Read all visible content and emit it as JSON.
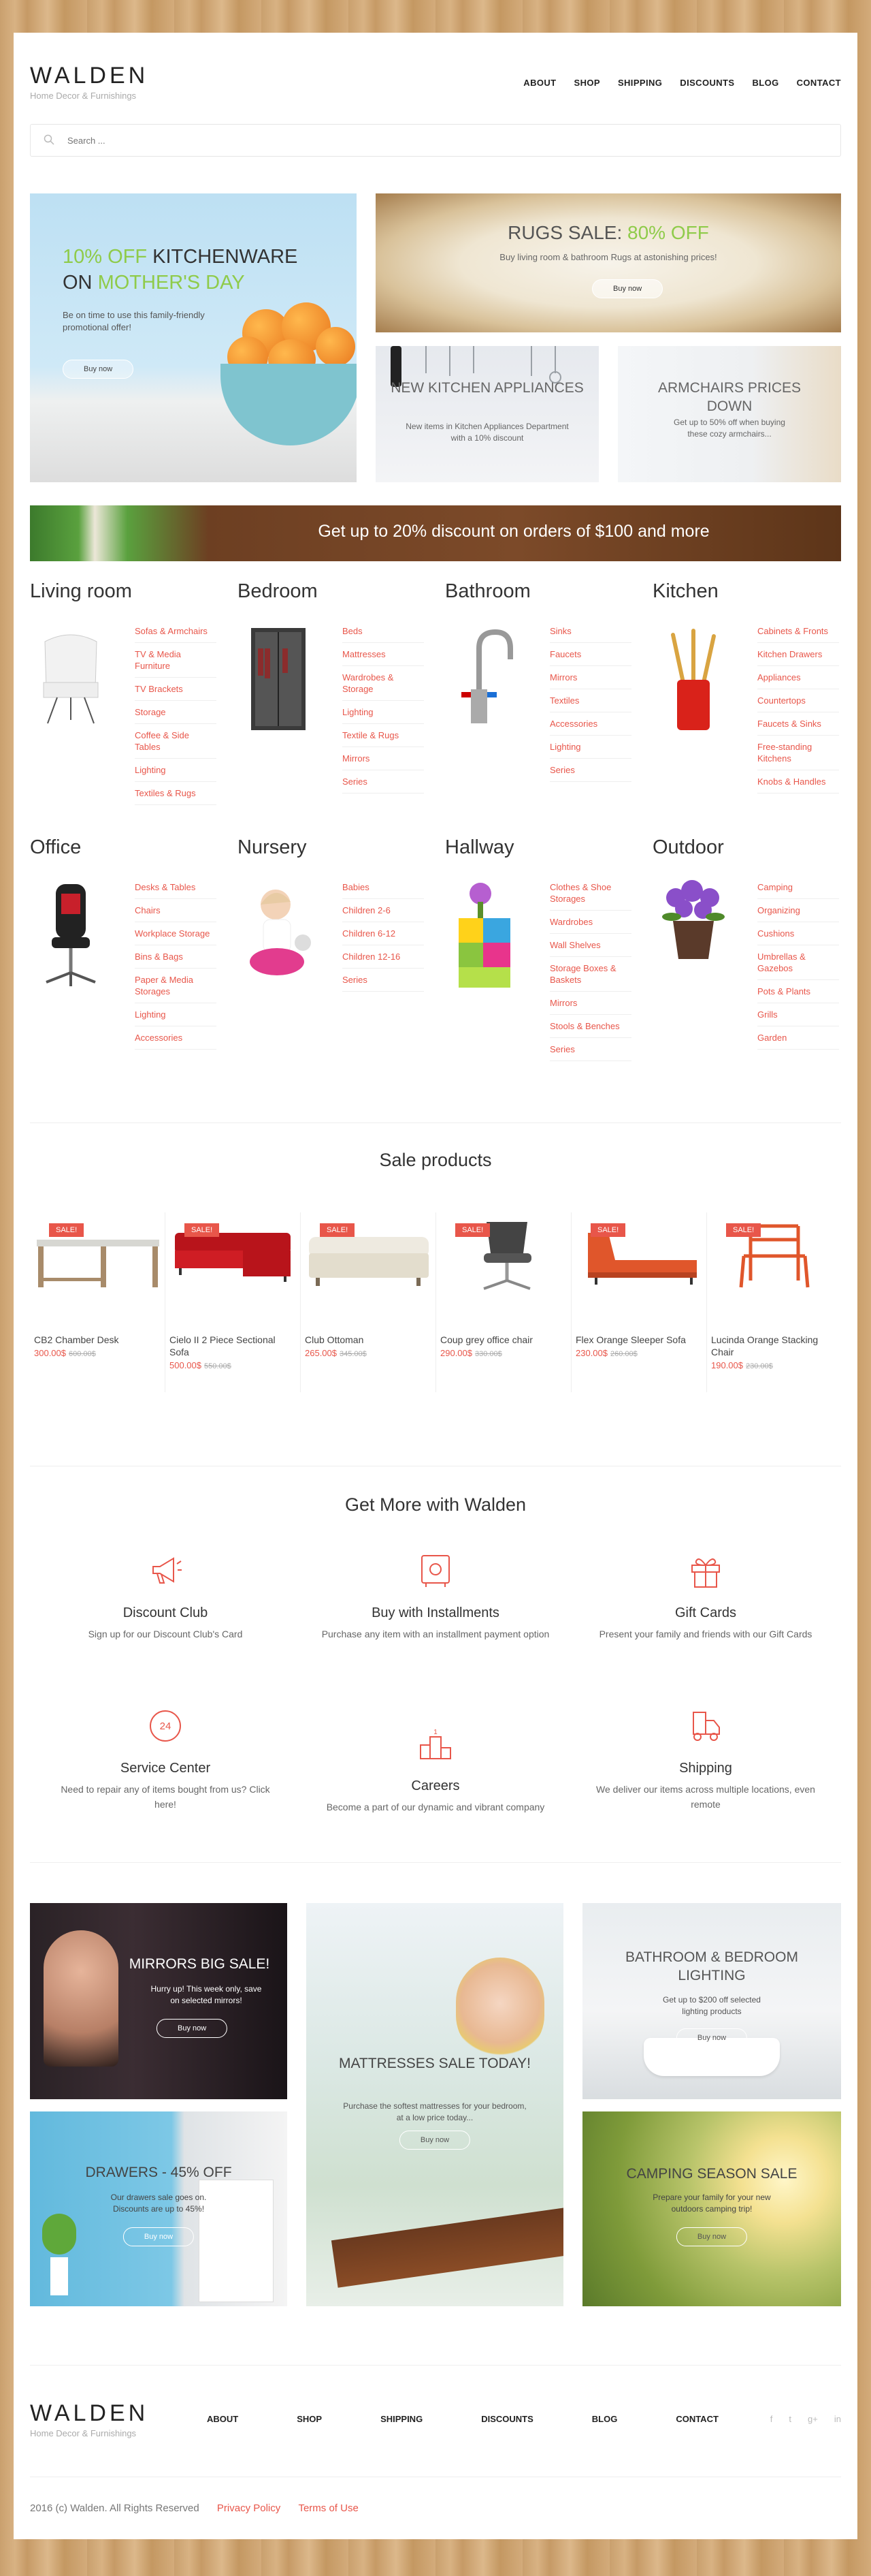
{
  "brand": {
    "name": "WALDEN",
    "tagline": "Home Decor & Furnishings"
  },
  "nav": [
    "ABOUT",
    "SHOP",
    "SHIPPING",
    "DISCOUNTS",
    "BLOG",
    "CONTACT"
  ],
  "search": {
    "placeholder": "Search ..."
  },
  "banners": {
    "kitchen": {
      "line1_accent": "10% OFF",
      "line1_rest": " KITCHENWARE",
      "line2_rest": "ON ",
      "line2_accent": "MOTHER'S DAY",
      "text": "Be on time to use this family-friendly promotional offer!",
      "button": "Buy now"
    },
    "rugs": {
      "title": "RUGS SALE: ",
      "title_accent": "80% OFF",
      "text": "Buy living room & bathroom Rugs at astonishing prices!",
      "button": "Buy now"
    },
    "appliances": {
      "title": "NEW KITCHEN APPLIANCES",
      "text": "New items in Kitchen Appliances Department with a 10% discount"
    },
    "armchairs": {
      "title": "ARMCHAIRS PRICES DOWN",
      "text": "Get up to 50% off when buying these cozy armchairs..."
    },
    "discount": {
      "text": "Get up to 20% discount on orders of $100 and more"
    }
  },
  "categories": [
    {
      "title": "Living room",
      "items": [
        "Sofas & Armchairs",
        "TV & Media Furniture",
        "TV Brackets",
        "Storage",
        "Coffee & Side Tables",
        "Lighting",
        "Textiles & Rugs"
      ]
    },
    {
      "title": "Bedroom",
      "items": [
        "Beds",
        "Mattresses",
        "Wardrobes & Storage",
        "Lighting",
        "Textile & Rugs",
        "Mirrors",
        "Series"
      ]
    },
    {
      "title": "Bathroom",
      "items": [
        "Sinks",
        "Faucets",
        "Mirrors",
        "Textiles",
        "Accessories",
        "Lighting",
        "Series"
      ]
    },
    {
      "title": "Kitchen",
      "items": [
        "Cabinets & Fronts",
        "Kitchen Drawers",
        "Appliances",
        "Countertops",
        "Faucets & Sinks",
        "Free-standing Kitchens",
        "Knobs & Handles"
      ]
    },
    {
      "title": "Office",
      "items": [
        "Desks & Tables",
        "Chairs",
        "Workplace Storage",
        "Bins & Bags",
        "Paper & Media Storages",
        "Lighting",
        "Accessories"
      ]
    },
    {
      "title": "Nursery",
      "items": [
        "Babies",
        "Children 2-6",
        "Children 6-12",
        "Children 12-16",
        "Series"
      ]
    },
    {
      "title": "Hallway",
      "items": [
        "Clothes & Shoe Storages",
        "Wardrobes",
        "Wall Shelves",
        "Storage Boxes & Baskets",
        "Mirrors",
        "Stools & Benches",
        "Series"
      ]
    },
    {
      "title": "Outdoor",
      "items": [
        "Camping",
        "Organizing",
        "Cushions",
        "Umbrellas & Gazebos",
        "Pots & Plants",
        "Grills",
        "Garden"
      ]
    }
  ],
  "sale": {
    "title": "Sale products",
    "badge": "SALE!",
    "products": [
      {
        "name": "CB2 Chamber Desk",
        "price": "300.00$",
        "old": "600.00$"
      },
      {
        "name": "Cielo II 2 Piece Sectional Sofa",
        "price": "500.00$",
        "old": "550.00$"
      },
      {
        "name": "Club Ottoman",
        "price": "265.00$",
        "old": "345.00$"
      },
      {
        "name": "Coup grey office chair",
        "price": "290.00$",
        "old": "330.00$"
      },
      {
        "name": "Flex Orange Sleeper Sofa",
        "price": "230.00$",
        "old": "260.00$"
      },
      {
        "name": "Lucinda Orange Stacking Chair",
        "price": "190.00$",
        "old": "230.00$"
      }
    ]
  },
  "services": {
    "title": "Get More with Walden",
    "items": [
      {
        "title": "Discount Club",
        "text": "Sign up for our Discount Club's Card"
      },
      {
        "title": "Buy with Installments",
        "text": "Purchase any item with an installment payment option"
      },
      {
        "title": "Gift Cards",
        "text": "Present your family and friends with our Gift Cards"
      },
      {
        "title": "Service Center",
        "text": "Need to repair any of items bought from us? Click here!"
      },
      {
        "title": "Careers",
        "text": "Become a part of our dynamic and vibrant company"
      },
      {
        "title": "Shipping",
        "text": "We deliver our items across multiple locations, even remote"
      }
    ]
  },
  "promos": {
    "mirrors": {
      "title": "MIRRORS BIG SALE!",
      "text": "Hurry up! This week only, save on selected mirrors!",
      "button": "Buy now"
    },
    "mattresses": {
      "title": "MATTRESSES SALE TODAY!",
      "text": "Purchase the softest mattresses for your bedroom, at a low price today...",
      "button": "Buy now"
    },
    "lighting": {
      "title": "BATHROOM & BEDROOM LIGHTING",
      "text": "Get up to $200 off selected lighting products",
      "button": "Buy now"
    },
    "drawers": {
      "title": "DRAWERS - 45% OFF",
      "text": "Our drawers sale goes on. Discounts are up to 45%!",
      "button": "Buy now"
    },
    "camping": {
      "title": "CAMPING SEASON SALE",
      "text": "Prepare your family for your new outdoors camping trip!",
      "button": "Buy now"
    }
  },
  "footer": {
    "nav": [
      "ABOUT",
      "SHOP",
      "SHIPPING",
      "DISCOUNTS",
      "BLOG",
      "CONTACT"
    ],
    "social": [
      "f",
      "t",
      "g+",
      "in"
    ],
    "copyright": "2016 (c) Walden. All Rights Reserved",
    "privacy": "Privacy Policy",
    "terms": "Terms of Use"
  }
}
